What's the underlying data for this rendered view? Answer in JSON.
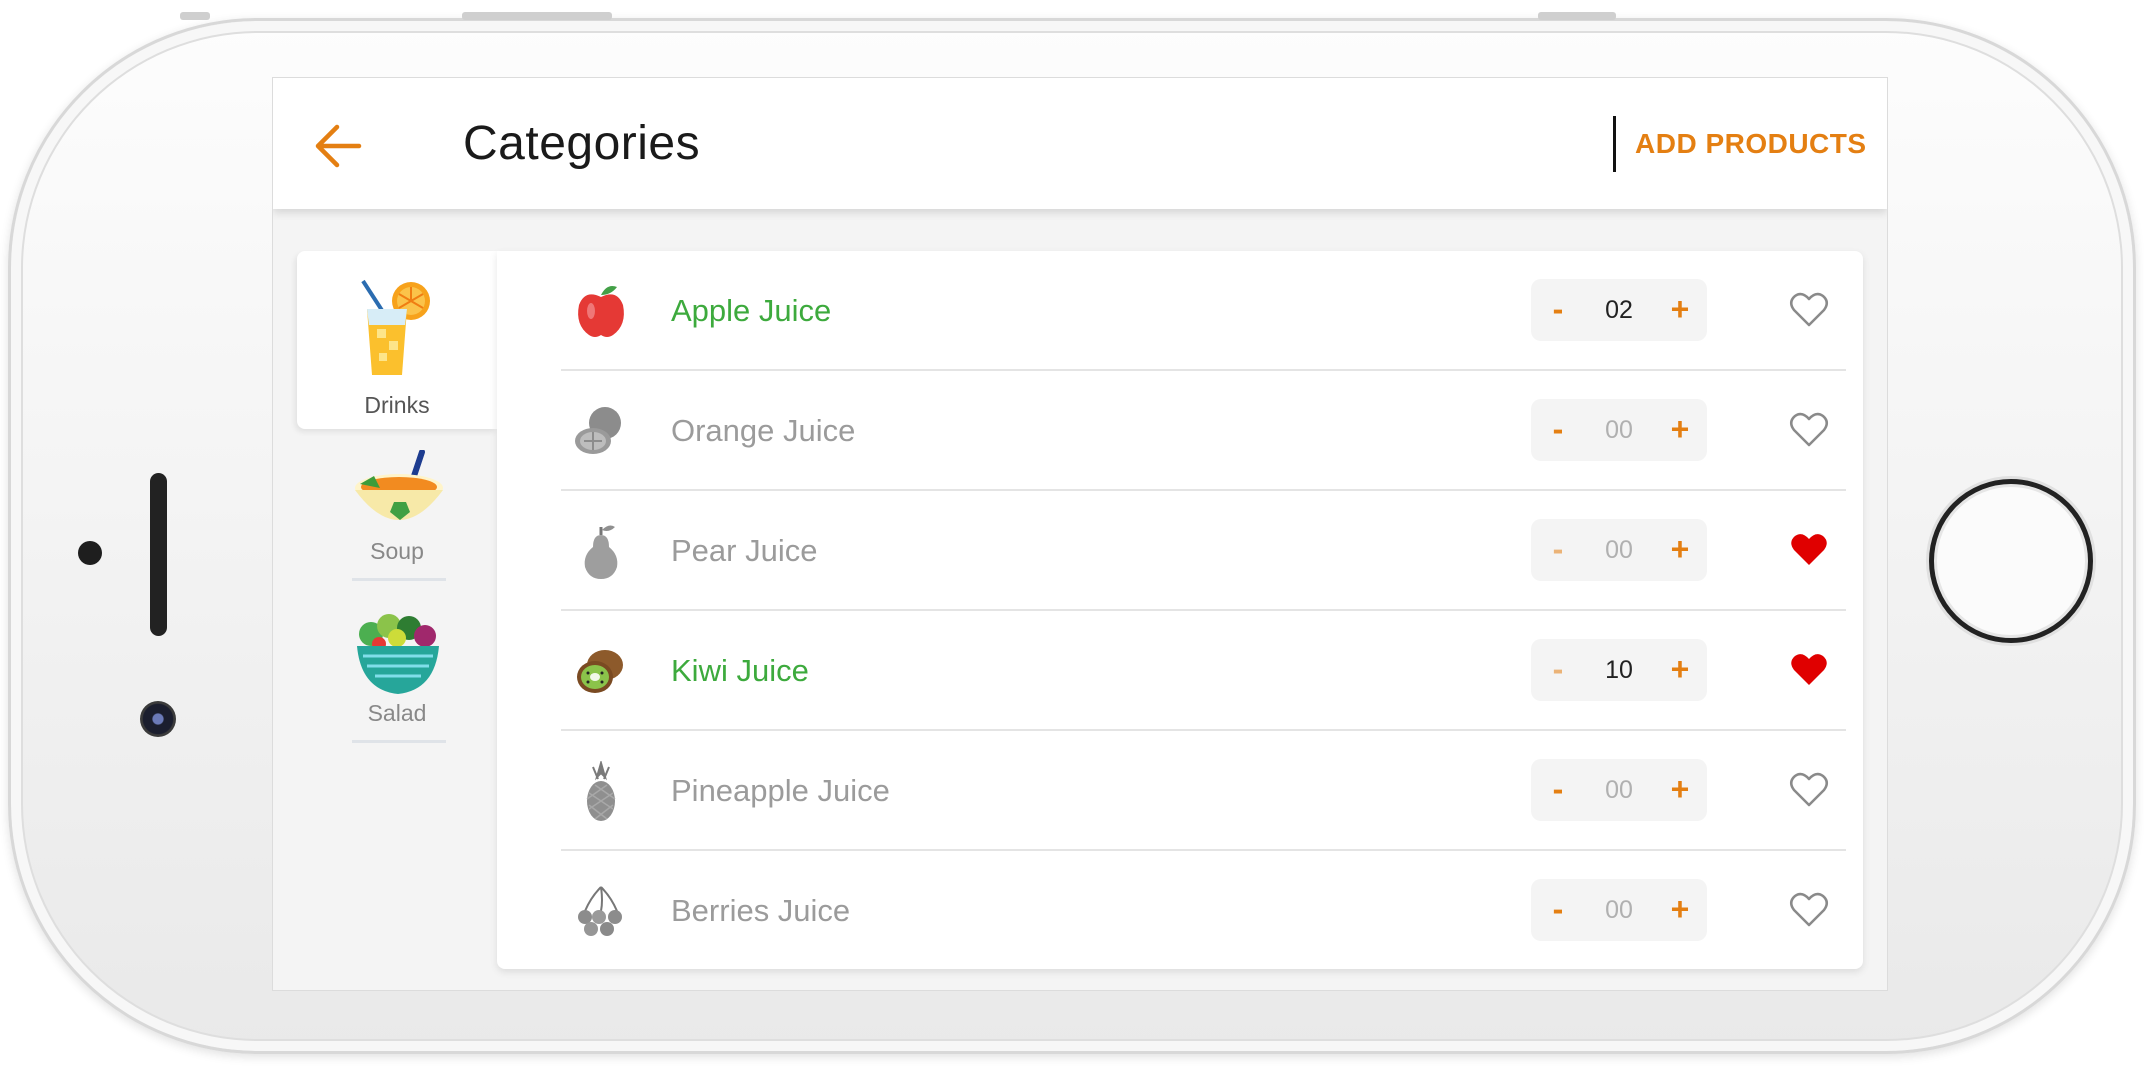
{
  "header": {
    "title": "Categories",
    "add_products_label": "ADD PRODUCTS"
  },
  "categories": [
    {
      "label": "Drinks",
      "selected": true,
      "icon": "drink-glass-icon"
    },
    {
      "label": "Soup",
      "selected": false,
      "icon": "soup-bowl-icon"
    },
    {
      "label": "Salad",
      "selected": false,
      "icon": "salad-bowl-icon"
    }
  ],
  "products": [
    {
      "name": "Apple Juice",
      "qty": "02",
      "favorite": false,
      "active": true,
      "icon": "apple-icon"
    },
    {
      "name": "Orange Juice",
      "qty": "00",
      "favorite": false,
      "active": false,
      "icon": "orange-icon"
    },
    {
      "name": "Pear Juice",
      "qty": "00",
      "favorite": true,
      "active": false,
      "icon": "pear-icon"
    },
    {
      "name": "Kiwi Juice",
      "qty": "10",
      "favorite": true,
      "active": true,
      "icon": "kiwi-icon"
    },
    {
      "name": "Pineapple Juice",
      "qty": "00",
      "favorite": false,
      "active": false,
      "icon": "pineapple-icon"
    },
    {
      "name": "Berries Juice",
      "qty": "00",
      "favorite": false,
      "active": false,
      "icon": "berries-icon"
    }
  ],
  "stepper": {
    "minus": "-",
    "plus": "+"
  },
  "colors": {
    "accent": "#e47f12",
    "active_text": "#3daa3d",
    "favorite": "#e00000",
    "muted_text": "#9b9b9b"
  }
}
